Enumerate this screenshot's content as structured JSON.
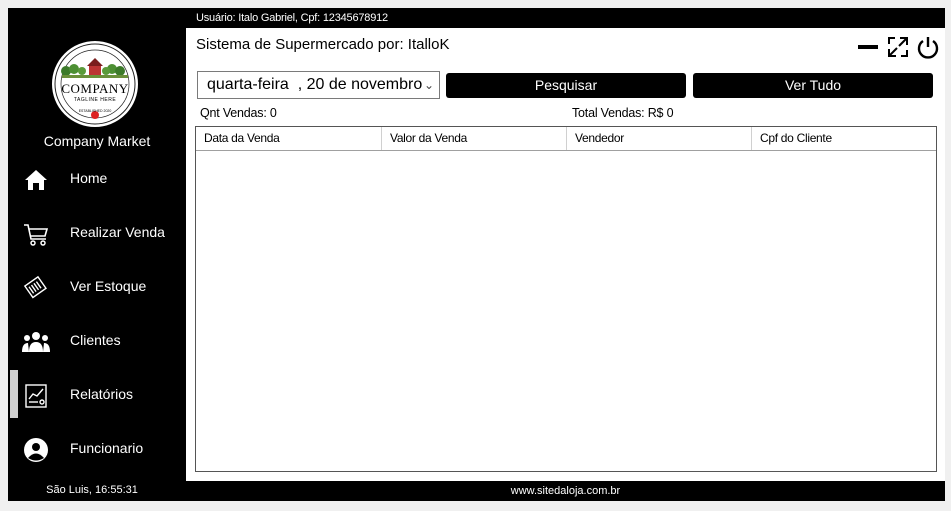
{
  "topbar": {
    "user_info": "Usuário: Italo Gabriel, Cpf: 12345678912"
  },
  "sidebar": {
    "company_name": "Company Market",
    "logo": {
      "main": "COMPANY",
      "tagline": "TAGLINE HERE",
      "established": "ESTABLISHED 2020"
    },
    "items": [
      {
        "label": "Home",
        "icon": "home-icon"
      },
      {
        "label": "Realizar Venda",
        "icon": "cart-icon"
      },
      {
        "label": "Ver Estoque",
        "icon": "stock-icon"
      },
      {
        "label": "Clientes",
        "icon": "clients-icon"
      },
      {
        "label": "Relatórios",
        "icon": "report-icon",
        "active": true
      },
      {
        "label": "Funcionario",
        "icon": "user-icon"
      }
    ],
    "clock": "São Luis, 16:55:31"
  },
  "header": {
    "title": "Sistema de Supermercado por: ItalloK"
  },
  "filters": {
    "date_value": "quarta-feira  , 20 de novembro",
    "search_label": "Pesquisar",
    "view_all_label": "Ver Tudo"
  },
  "stats": {
    "qnt_vendas": "Qnt Vendas: 0",
    "total_vendas": "Total Vendas: R$ 0"
  },
  "table": {
    "columns": [
      "Data da Venda",
      "Valor da Venda",
      "Vendedor",
      "Cpf do Cliente"
    ],
    "rows": []
  },
  "footer": {
    "site": "www.sitedaloja.com.br"
  },
  "colors": {
    "sidebar_bg": "#000000",
    "active_indicator": "#d0d0d0",
    "content_bg": "#ffffff"
  }
}
